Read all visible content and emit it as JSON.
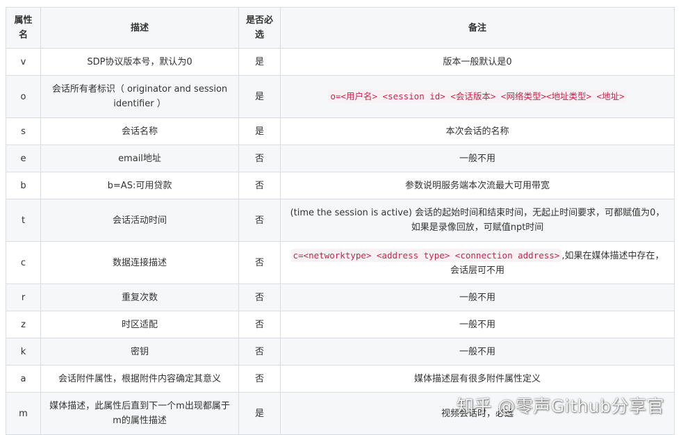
{
  "table": {
    "headers": {
      "name": "属性名",
      "description": "描述",
      "required": "是否必选",
      "note": "备注"
    },
    "rows": [
      {
        "name": "v",
        "description": "SDP协议版本号，默认为0",
        "required": "是",
        "note": "版本一般默认是0"
      },
      {
        "name": "o",
        "description": "会话所有者标识（ originator and session identifier ）",
        "required": "是",
        "note_code": "o=<用户名> <session id> <会话版本> <网络类型><地址类型> <地址>"
      },
      {
        "name": "s",
        "description": "会话名称",
        "required": "是",
        "note": "本次会话的名称"
      },
      {
        "name": "e",
        "description": "email地址",
        "required": "否",
        "note": "一般不用"
      },
      {
        "name": "b",
        "description": "b=AS:可用贷款",
        "required": "否",
        "note": "参数说明服务端本次流最大可用带宽"
      },
      {
        "name": "t",
        "description": "会话活动时间",
        "required": "否",
        "note": "(time the session is active) 会话的起始时间和结束时间，无起止时间要求，可都赋值为0，如果是录像回放，可赋值npt时间"
      },
      {
        "name": "c",
        "description": "数据连接描述",
        "required": "否",
        "note_code": "c=<networktype> <address type> <connection address>",
        "note": ",如果在媒体描述中存在，会话层可不用"
      },
      {
        "name": "r",
        "description": "重复次数",
        "required": "否",
        "note": "一般不用"
      },
      {
        "name": "z",
        "description": "时区适配",
        "required": "否",
        "note": "一般不用"
      },
      {
        "name": "k",
        "description": "密钥",
        "required": "否",
        "note": "一般不用"
      },
      {
        "name": "a",
        "description": "会话附件属性，根据附件内容确定其意义",
        "required": "否",
        "note": "媒体描述层有很多附件属性定义"
      },
      {
        "name": "m",
        "description": "媒体描述，此属性后直到下一个m出现都属于m的属性描述",
        "required": "是",
        "note": "视频会话时，必选"
      }
    ]
  },
  "watermark": "知乎 @零声Github分享官"
}
